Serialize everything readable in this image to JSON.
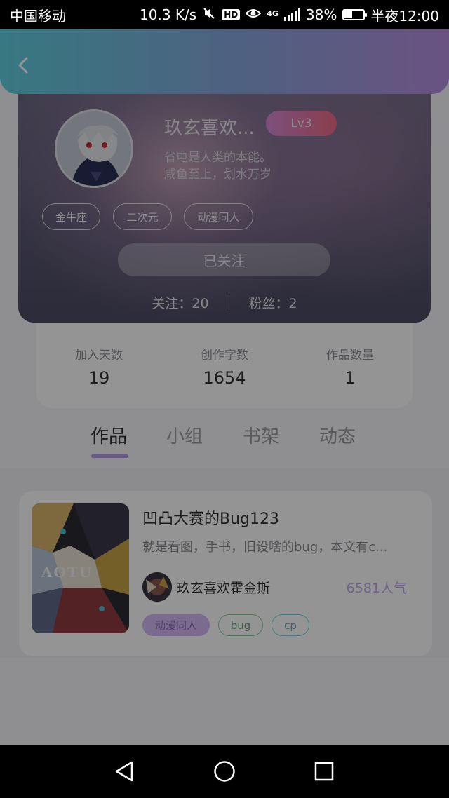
{
  "status_bar": {
    "carrier": "中国移动",
    "speed": "10.3 K/s",
    "hd": "HD",
    "network": "4G",
    "battery": "38%",
    "time": "半夜12:00"
  },
  "profile": {
    "name": "玖玄喜欢...",
    "level": "Lv3",
    "bio_line1": "省电是人类的本能。",
    "bio_line2": "咸鱼至上，划水万岁",
    "tags": [
      "金牛座",
      "二次元",
      "动漫同人"
    ],
    "follow_button": "已关注",
    "following": "关注：20",
    "fans": "粉丝：2"
  },
  "counts": [
    {
      "label": "加入天数",
      "value": "19"
    },
    {
      "label": "创作字数",
      "value": "1654"
    },
    {
      "label": "作品数量",
      "value": "1"
    }
  ],
  "tabs": [
    "作品",
    "小组",
    "书架",
    "动态"
  ],
  "active_tab": "作品",
  "work": {
    "title": "凹凸大赛的Bug123",
    "description": "就是看图，手书，旧设啥的bug，本文有c...",
    "cover_text": "AOTU",
    "author": "玖玄喜欢霍金斯",
    "popularity": "6581人气",
    "tags": [
      "动漫同人",
      "bug",
      "cp"
    ]
  },
  "colors": {
    "header_gradient": [
      "#5fd0e0",
      "#b78fe0"
    ],
    "accent": "#b59ae8",
    "level_gradient": [
      "#d58ad8",
      "#f06a84"
    ]
  },
  "icons": {
    "back": "chevron-left-icon",
    "mute": "mute-icon",
    "eye": "eye-comfort-icon",
    "nav_back": "triangle-back-icon",
    "nav_home": "circle-home-icon",
    "nav_recent": "square-recent-icon"
  }
}
